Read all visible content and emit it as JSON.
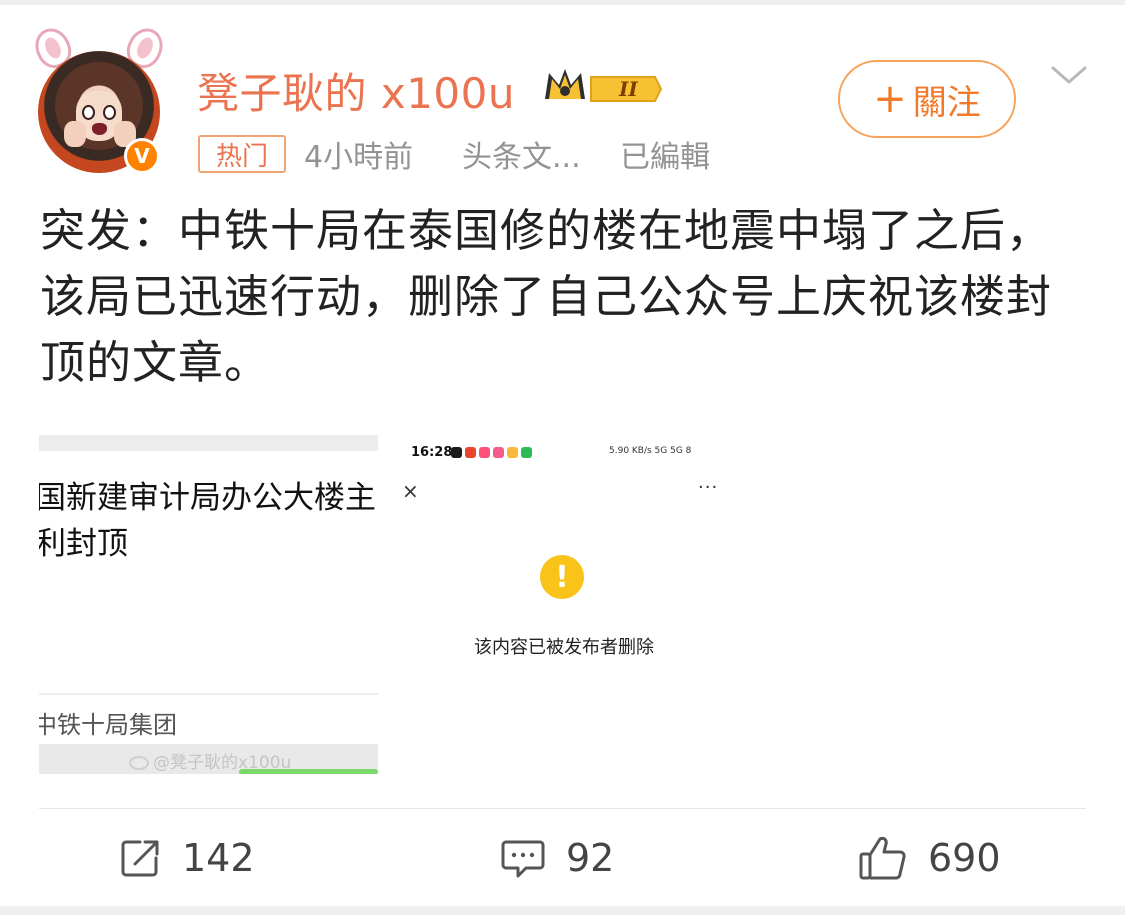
{
  "post": {
    "username": "凳子耿的 x100u",
    "member_level": "II",
    "verified_badge": "V",
    "hot_tag": "热门",
    "time": "4小時前",
    "source": "头条文...",
    "edited": "已編輯",
    "follow_label": "關注",
    "follow_plus": "+",
    "text": "突发：中铁十局在泰国修的楼在地震中塌了之后，该局已迅速行动，删除了自己公众号上庆祝该楼封顶的文章。"
  },
  "images": [
    {
      "title_line1": "国新建审计局办公大楼主",
      "title_line2": "利封顶",
      "author": "中铁十局集团",
      "watermark": "@凳子耿的x100u"
    },
    {
      "status_time": "16:28",
      "status_right": "5.90 KB/s  5G  5G  8",
      "close_glyph": "×",
      "more_glyph": "···",
      "warning_glyph": "!",
      "message": "该内容已被发布者删除"
    }
  ],
  "actions": {
    "repost_count": "142",
    "comment_count": "92",
    "like_count": "690"
  },
  "colors": {
    "username": "#eb7350",
    "follow_border": "#f7a35c",
    "verified": "#ff8200",
    "warning": "#f9c31a"
  },
  "icons": [
    "chevron-down-icon",
    "repost-icon",
    "comment-icon",
    "like-icon",
    "crown-icon",
    "warning-icon"
  ]
}
